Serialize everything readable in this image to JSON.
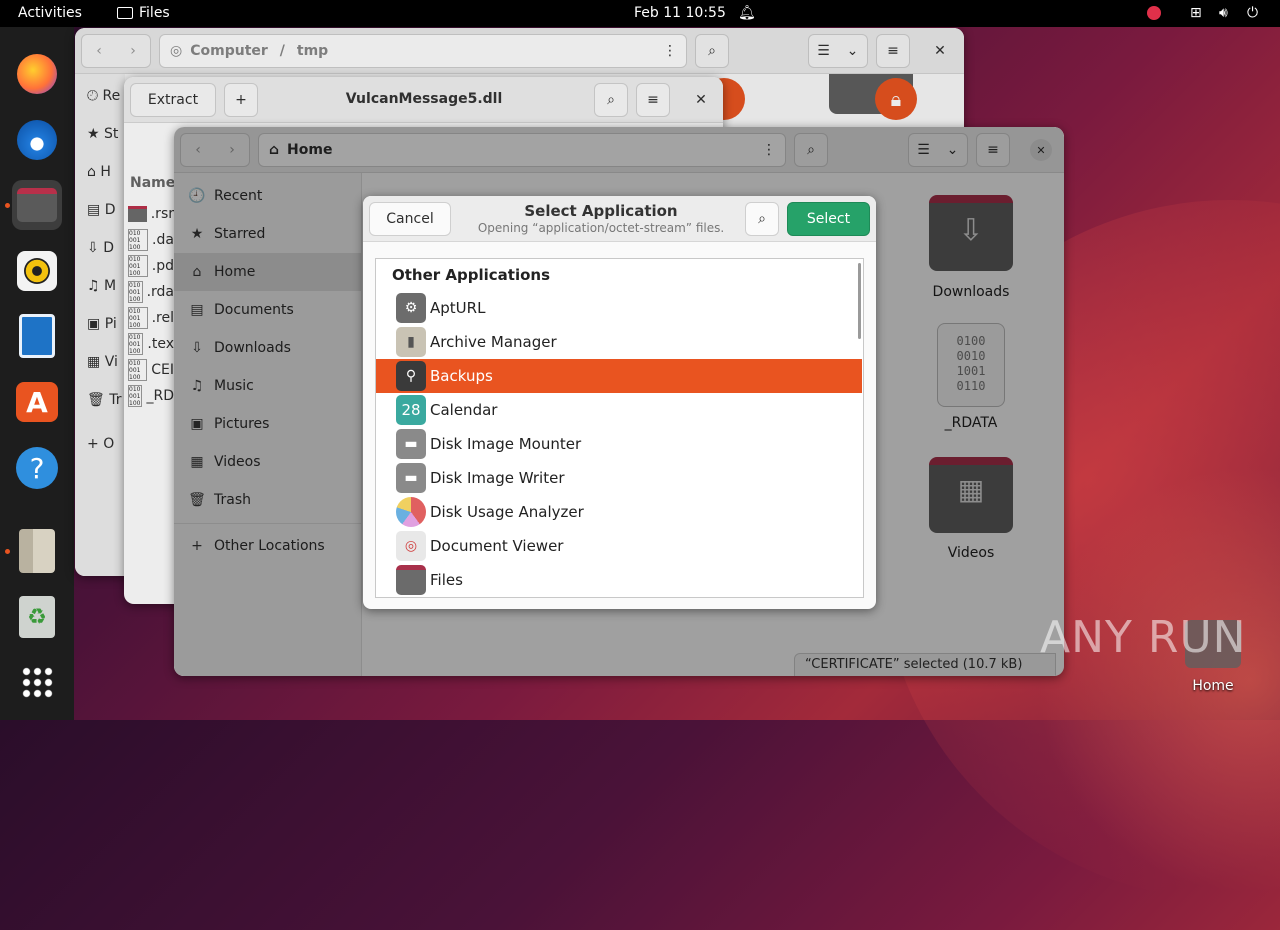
{
  "topbar": {
    "activities": "Activities",
    "app": "Files",
    "clock": "Feb 11  10:55"
  },
  "dock": [
    {
      "name": "firefox-icon"
    },
    {
      "name": "thunderbird-icon"
    },
    {
      "name": "files-icon"
    },
    {
      "name": "rhythmbox-icon"
    },
    {
      "name": "writer-icon"
    },
    {
      "name": "app-center-icon"
    },
    {
      "name": "help-icon"
    },
    {
      "name": "archive-manager-icon"
    },
    {
      "name": "trash-icon"
    },
    {
      "name": "show-apps-icon"
    }
  ],
  "win_back": {
    "path_root": "Computer",
    "path_sep": "/",
    "path_dir": "tmp",
    "sidebar": [
      "Re",
      "St",
      "H",
      "D",
      "D",
      "M",
      "Pi",
      "Vi",
      "Tr",
      "O"
    ]
  },
  "win_mid": {
    "extract": "Extract",
    "title": "VulcanMessage5.dll",
    "col_name": "Name",
    "files": [
      ".rsr",
      ".da",
      ".pd",
      ".rda",
      ".rel",
      ".tex",
      "CEI",
      "_RD"
    ]
  },
  "win_front": {
    "path": "Home",
    "sidebar": [
      {
        "label": "Recent",
        "icon": "🕘"
      },
      {
        "label": "Starred",
        "icon": "★"
      },
      {
        "label": "Home",
        "icon": "⌂"
      },
      {
        "label": "Documents",
        "icon": "▤"
      },
      {
        "label": "Downloads",
        "icon": "⇩"
      },
      {
        "label": "Music",
        "icon": "♫"
      },
      {
        "label": "Pictures",
        "icon": "▣"
      },
      {
        "label": "Videos",
        "icon": "▦"
      },
      {
        "label": "Trash",
        "icon": "🗑"
      }
    ],
    "other_locations": "Other Locations",
    "plus": "+",
    "folders": {
      "downloads": "Downloads",
      "rdata": "_RDATA",
      "videos": "Videos"
    },
    "status": "“CERTIFICATE” selected  (10.7 kB)"
  },
  "dialog": {
    "cancel": "Cancel",
    "title": "Select Application",
    "subtitle": "Opening “application/octet-stream” files.",
    "select": "Select",
    "section": "Other Applications",
    "apps": [
      {
        "label": "AptURL",
        "icon": "⚙",
        "color": "#6c6c6c"
      },
      {
        "label": "Archive Manager",
        "icon": "▮",
        "color": "#c9c3b4"
      },
      {
        "label": "Backups",
        "icon": "⚲",
        "color": "#3a3a3a"
      },
      {
        "label": "Calendar",
        "icon": "28",
        "color": "#3aa99f"
      },
      {
        "label": "Disk Image Mounter",
        "icon": "▬",
        "color": "#8a8a8a"
      },
      {
        "label": "Disk Image Writer",
        "icon": "▬",
        "color": "#8a8a8a"
      },
      {
        "label": "Disk Usage Analyzer",
        "icon": "◕",
        "color": "#e06060"
      },
      {
        "label": "Document Viewer",
        "icon": "◎",
        "color": "#d0d0d0"
      },
      {
        "label": "Files",
        "icon": "▭",
        "color": "#6b6b6b"
      }
    ],
    "selected_index": 2
  },
  "desktop": {
    "home_label": "Home",
    "watermark": "ANY RUN"
  }
}
